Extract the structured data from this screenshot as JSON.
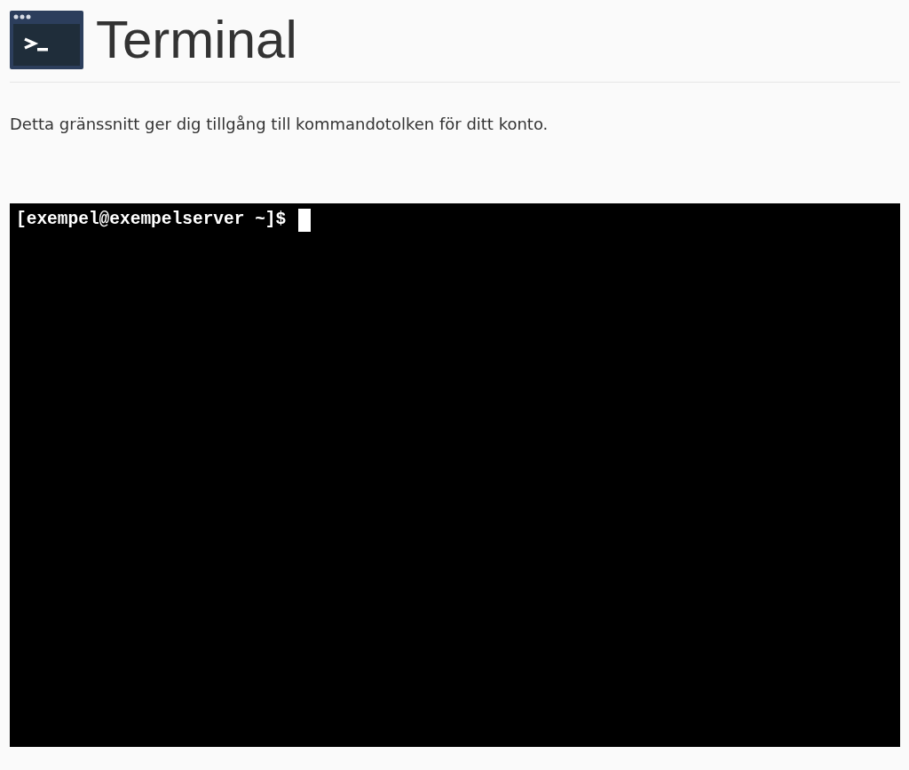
{
  "header": {
    "title": "Terminal"
  },
  "description": "Detta gränssnitt ger dig tillgång till kommandotolken för ditt konto.",
  "terminal": {
    "prompt": "[exempel@exempelserver ~]$"
  }
}
